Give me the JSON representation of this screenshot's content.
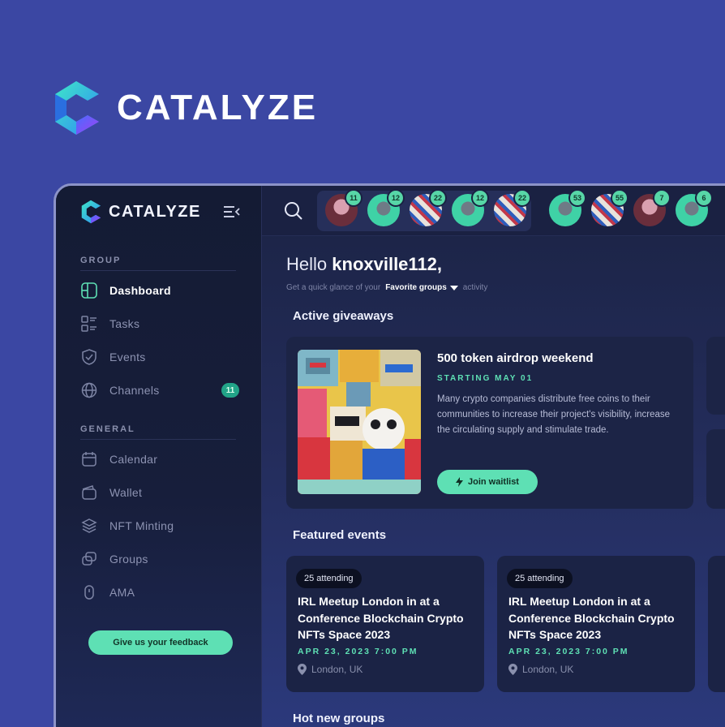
{
  "brand": {
    "name": "CATALYZE"
  },
  "sidebar": {
    "logo_text": "CATALYZE",
    "sections": [
      {
        "title": "GROUP"
      },
      {
        "title": "GENERAL"
      }
    ],
    "items": [
      {
        "label": "Dashboard",
        "icon": "dashboard-icon",
        "active": true
      },
      {
        "label": "Tasks",
        "icon": "tasks-icon"
      },
      {
        "label": "Events",
        "icon": "events-icon"
      },
      {
        "label": "Channels",
        "icon": "channels-icon",
        "badge": "11"
      },
      {
        "label": "Calendar",
        "icon": "calendar-icon"
      },
      {
        "label": "Wallet",
        "icon": "wallet-icon"
      },
      {
        "label": "NFT Minting",
        "icon": "nft-icon"
      },
      {
        "label": "Groups",
        "icon": "groups-icon"
      },
      {
        "label": "AMA",
        "icon": "ama-icon"
      }
    ],
    "feedback_label": "Give us your feedback"
  },
  "topbar": {
    "avatars": [
      "11",
      "12",
      "22",
      "12",
      "22",
      "53",
      "55",
      "7",
      "6"
    ]
  },
  "main": {
    "greeting": "Hello",
    "username": "knoxville112,",
    "sub_prefix": "Get a quick glance of your",
    "sub_select": "Favorite groups",
    "sub_suffix": "activity",
    "active_giveaways_title": "Active giveaways",
    "featured_events_title": "Featured events",
    "hot_groups_title": "Hot new groups",
    "giveaway": {
      "title": "500 token airdrop weekend",
      "date": "STARTING MAY 01",
      "description": "Many crypto companies distribute free coins to their communities to increase their project's visibility, increase the circulating supply and stimulate trade.",
      "button": "Join waitlist"
    },
    "events": [
      {
        "attending": "25 attending",
        "title": "IRL Meetup London in at a Conference Blockchain Crypto NFTs Space 2023",
        "date": "APR 23, 2023 7:00 PM",
        "location": "London, UK"
      },
      {
        "attending": "25 attending",
        "title": "IRL Meetup London in at a Conference Blockchain Crypto NFTs Space 2023",
        "date": "APR 23, 2023 7:00 PM",
        "location": "London, UK"
      }
    ]
  },
  "colors": {
    "background": "#3b47a3",
    "accent": "#5ee0b4",
    "panel": "#1c2446"
  }
}
